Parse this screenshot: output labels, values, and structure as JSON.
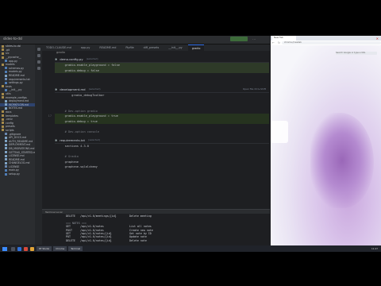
{
  "ide": {
    "window_title": "slides-to-dsl",
    "run_config": "Python Gradio Tests",
    "project_tree": [
      {
        "label": "slides-to-dsl",
        "type": "folder",
        "selected": false
      },
      {
        "label": ".git",
        "type": "folder",
        "selected": false
      },
      {
        "label": "src",
        "type": "folder",
        "selected": false
      },
      {
        "label": "__pycache__",
        "type": "folder",
        "selected": false
      },
      {
        "label": "app.py",
        "type": "pyfile",
        "selected": false
      },
      {
        "label": "models",
        "type": "folder",
        "selected": false
      },
      {
        "label": "schemas.py",
        "type": "pyfile",
        "selected": false
      },
      {
        "label": "models.py",
        "type": "pyfile",
        "selected": false
      },
      {
        "label": "README.md",
        "type": "mdfile",
        "selected": false
      },
      {
        "label": "requirements.txt",
        "type": "file",
        "selected": false
      },
      {
        "label": "settings.py",
        "type": "pyfile",
        "selected": false
      },
      {
        "label": "tests",
        "type": "folder",
        "selected": false
      },
      {
        "label": "__init__.py",
        "type": "pyfile",
        "selected": false
      },
      {
        "label": "utils",
        "type": "folder",
        "selected": false
      },
      {
        "label": "example_configs",
        "type": "folder",
        "selected": false
      },
      {
        "label": "deployment.md",
        "type": "mdfile",
        "selected": false
      },
      {
        "label": "WORKFLOW.md",
        "type": "mdfile",
        "selected": true
      },
      {
        "label": "NOTES.md",
        "type": "mdfile",
        "selected": false
      },
      {
        "label": "docs",
        "type": "folder",
        "selected": false
      },
      {
        "label": "templates",
        "type": "folder",
        "selected": false
      },
      {
        "label": ".venv",
        "type": "folder",
        "selected": false
      },
      {
        "label": "config",
        "type": "folder",
        "selected": false
      },
      {
        "label": "presets",
        "type": "folder",
        "selected": false
      },
      {
        "label": "scripts",
        "type": "folder",
        "selected": false
      },
      {
        "label": ".gitignore",
        "type": "file",
        "selected": false
      },
      {
        "label": "API_DOCS.md",
        "type": "mdfile",
        "selected": false
      },
      {
        "label": "AUTH_README.md",
        "type": "mdfile",
        "selected": false
      },
      {
        "label": "DEPLOYMENT.md",
        "type": "mdfile",
        "selected": false
      },
      {
        "label": "DB_MIGRATIONS.md",
        "type": "mdfile",
        "selected": false
      },
      {
        "label": "GETTING_STARTED.md",
        "type": "mdfile",
        "selected": false
      },
      {
        "label": "LICENSE.md",
        "type": "mdfile",
        "selected": false
      },
      {
        "label": "README.md",
        "type": "mdfile",
        "selected": false
      },
      {
        "label": "CHANGELOG.md",
        "type": "mdfile",
        "selected": false
      },
      {
        "label": "LICENSE",
        "type": "file",
        "selected": false
      },
      {
        "label": "main.py",
        "type": "pyfile",
        "selected": false
      },
      {
        "label": "setup.py",
        "type": "pyfile",
        "selected": false
      }
    ],
    "tabs": [
      {
        "label": "TODO-CLAUDE.md",
        "active": false
      },
      {
        "label": "app.py",
        "active": false
      },
      {
        "label": "README.md",
        "active": false
      },
      {
        "label": "Pipfile",
        "active": false
      },
      {
        "label": "diff_presets",
        "active": false
      },
      {
        "label": "__init__.py",
        "active": false
      },
      {
        "label": "gradio",
        "active": true
      }
    ],
    "breadcrumb": "gradio",
    "sections": [
      {
        "title": "demo.config.py",
        "badge": "(selected)",
        "right": "",
        "lines": [
          {
            "n": "",
            "text": "    gradio.enable_playground = false",
            "kind": "hl"
          },
          {
            "n": "",
            "text": "    gradio.debug = false",
            "kind": "hl"
          },
          {
            "n": "",
            "text": "",
            "kind": ""
          },
          {
            "n": "",
            "text": "",
            "kind": ""
          }
        ]
      },
      {
        "title": "development.md",
        "badge": "(selected)",
        "right": "Open file  Ctrl+Shift",
        "lines": [
          {
            "n": "",
            "text": "        gradio_debugToolbar",
            "kind": ""
          },
          {
            "n": "",
            "text": "",
            "kind": ""
          },
          {
            "n": "",
            "text": "",
            "kind": ""
          },
          {
            "n": "",
            "text": "    # Dev-option gradio",
            "kind": "cmt"
          },
          {
            "n": "17",
            "text": "    gradio.enable_playground = true",
            "kind": "hl2"
          },
          {
            "n": "",
            "text": "    gradio.debug = true",
            "kind": "hl2"
          },
          {
            "n": "",
            "text": "",
            "kind": ""
          },
          {
            "n": "",
            "text": "    # Dev-option console",
            "kind": "cmt"
          }
        ]
      },
      {
        "title": "requirements.txt",
        "badge": "(selected)",
        "right": "",
        "lines": [
          {
            "n": "",
            "text": "    sections 4.3.0",
            "kind": ""
          },
          {
            "n": "",
            "text": "",
            "kind": ""
          },
          {
            "n": "",
            "text": "    # Gradio",
            "kind": "cmt"
          },
          {
            "n": "",
            "text": "    graphene",
            "kind": ""
          },
          {
            "n": "",
            "text": "    graphene-sqlalchemy",
            "kind": ""
          }
        ]
      }
    ],
    "terminal": {
      "tab_label": "Terminal  Local",
      "lines": [
        {
          "m": "DELETE",
          "p": "/api/v1.0/meetings/{id}",
          "d": "Delete meeting"
        },
        {
          "m": "",
          "p": "",
          "d": ""
        },
        {
          "m": "=== NOTES ===",
          "p": "",
          "d": ""
        },
        {
          "m": "GET",
          "p": "/api/v1.0/notes",
          "d": "List all notes"
        },
        {
          "m": "POST",
          "p": "/api/v1.0/notes",
          "d": "Create new note"
        },
        {
          "m": "GET",
          "p": "/api/v1.0/notes/{id}",
          "d": "Get note by ID"
        },
        {
          "m": "PUT",
          "p": "/api/v1.0/notes/{id}",
          "d": "Update note"
        },
        {
          "m": "DELETE",
          "p": "/api/v1.0/notes/{id}",
          "d": "Delete note"
        },
        {
          "m": "",
          "p": "",
          "d": ""
        },
        {
          "m": "=== REPORTS ===",
          "p": "",
          "d": ""
        },
        {
          "m": "GET",
          "p": "/api/v1.0/reports/upcoming-meetings",
          "d": "Upcoming meetings report"
        },
        {
          "m": "GET",
          "p": "/api/v1.0/reports/contact-history/{id}",
          "d": "Contact history report"
        },
        {
          "m": "",
          "p": "",
          "d": ""
        },
        {
          "m": "For detailed API documentation, see STRUCTURES.md",
          "p": "",
          "d": ""
        }
      ]
    },
    "status": {
      "left": "slides-to-dsl",
      "pos": "17:34",
      "enc": "UTF-8",
      "indent": "4 spaces",
      "lang": "Python 3.11"
    }
  },
  "browser": {
    "tab_label": "New Tab",
    "url": "chrome://newtab",
    "toolbar_text": "Search Google or type a URL"
  },
  "taskbar": {
    "items": [
      "RT Studio",
      "Chrome",
      "Terminal"
    ],
    "time": "11:47"
  },
  "colors": {
    "accent": "#3574f0",
    "ide_bg": "#1e1f22",
    "sidebar_bg": "#2b2d30",
    "highlight": "#3f5b2a"
  }
}
